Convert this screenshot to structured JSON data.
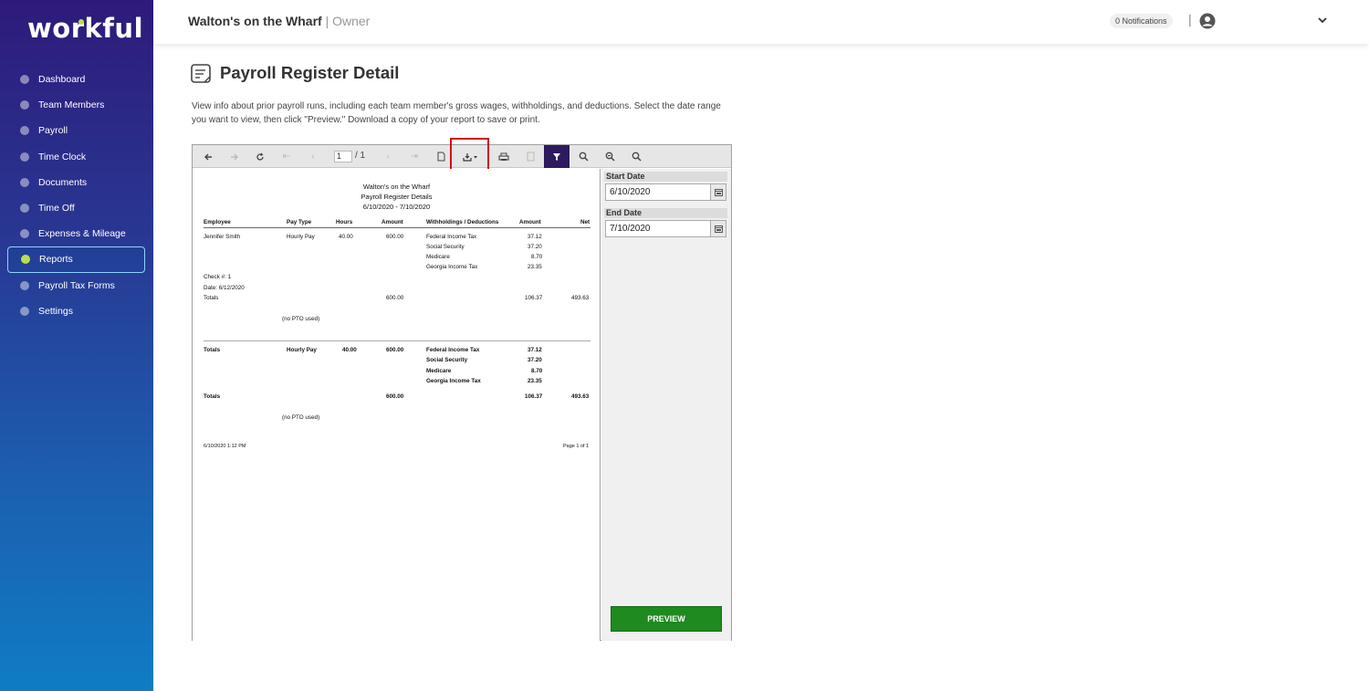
{
  "app": {
    "logo": "workful"
  },
  "sidebar": {
    "items": [
      {
        "label": "Dashboard"
      },
      {
        "label": "Team Members"
      },
      {
        "label": "Payroll"
      },
      {
        "label": "Time Clock"
      },
      {
        "label": "Documents"
      },
      {
        "label": "Time Off"
      },
      {
        "label": "Expenses & Mileage"
      },
      {
        "label": "Reports",
        "active": true
      },
      {
        "label": "Payroll Tax Forms"
      },
      {
        "label": "Settings"
      }
    ]
  },
  "header": {
    "company": "Walton's on the Wharf",
    "role": "| Owner",
    "notifications": "0 Notifications",
    "separator": "|"
  },
  "page": {
    "title": "Payroll Register Detail",
    "description": "View info about prior payroll runs, including each team member's gross wages, withholdings, and deductions. Select the date range you want to view, then click \"Preview.\" Download a copy of your report to save or print."
  },
  "toolbar": {
    "page_current": "1",
    "page_total": "/ 1",
    "icons": [
      "back-icon",
      "forward-icon",
      "refresh-icon",
      "first-page-icon",
      "prev-page-icon",
      "next-page-icon",
      "last-page-icon",
      "document-icon",
      "download-icon",
      "print-icon",
      "print-layout-icon",
      "filter-icon",
      "zoom-in-icon",
      "zoom-out-icon",
      "search-icon"
    ],
    "highlight_color": "#d0111b"
  },
  "report": {
    "title_lines": [
      "Walton's on the Wharf",
      "Payroll Register Details",
      "6/10/2020 - 7/10/2020"
    ],
    "columns": [
      "Employee",
      "Pay Type",
      "Hours",
      "Amount",
      "Withholdings / Deductions",
      "Amount",
      "Net"
    ],
    "employee": {
      "name": "Jennifer Smith",
      "pay_type": "Hourly Pay",
      "hours": "40.00",
      "amount": "600.00",
      "withholdings": [
        {
          "label": "Federal Income Tax",
          "amount": "37.12"
        },
        {
          "label": "Social Security",
          "amount": "37.20"
        },
        {
          "label": "Medicare",
          "amount": "8.70"
        },
        {
          "label": "Georgia Income Tax",
          "amount": "23.35"
        }
      ],
      "check": "Check #: 1",
      "date": "Date: 6/12/2020",
      "totals_label": "Totals",
      "totals_amount": "600.00",
      "totals_withholding": "106.37",
      "totals_net": "493.63",
      "pto": "(no PTO used)"
    },
    "grand": {
      "label": "Totals",
      "pay_type": "Hourly Pay",
      "hours": "40.00",
      "amount": "600.00",
      "withholdings": [
        {
          "label": "Federal Income Tax",
          "amount": "37.12"
        },
        {
          "label": "Social Security",
          "amount": "37.20"
        },
        {
          "label": "Medicare",
          "amount": "8.70"
        },
        {
          "label": "Georgia Income Tax",
          "amount": "23.35"
        }
      ],
      "totals_label": "Totals",
      "totals_amount": "600.00",
      "totals_withholding": "106.37",
      "totals_net": "493.63",
      "pto": "(no PTO used)"
    },
    "footer_left": "6/10/2020  1:12 PM",
    "footer_right": "Page 1 of 1"
  },
  "params": {
    "start_label": "Start Date",
    "start_value": "6/10/2020",
    "end_label": "End Date",
    "end_value": "7/10/2020",
    "preview_label": "PREVIEW"
  }
}
